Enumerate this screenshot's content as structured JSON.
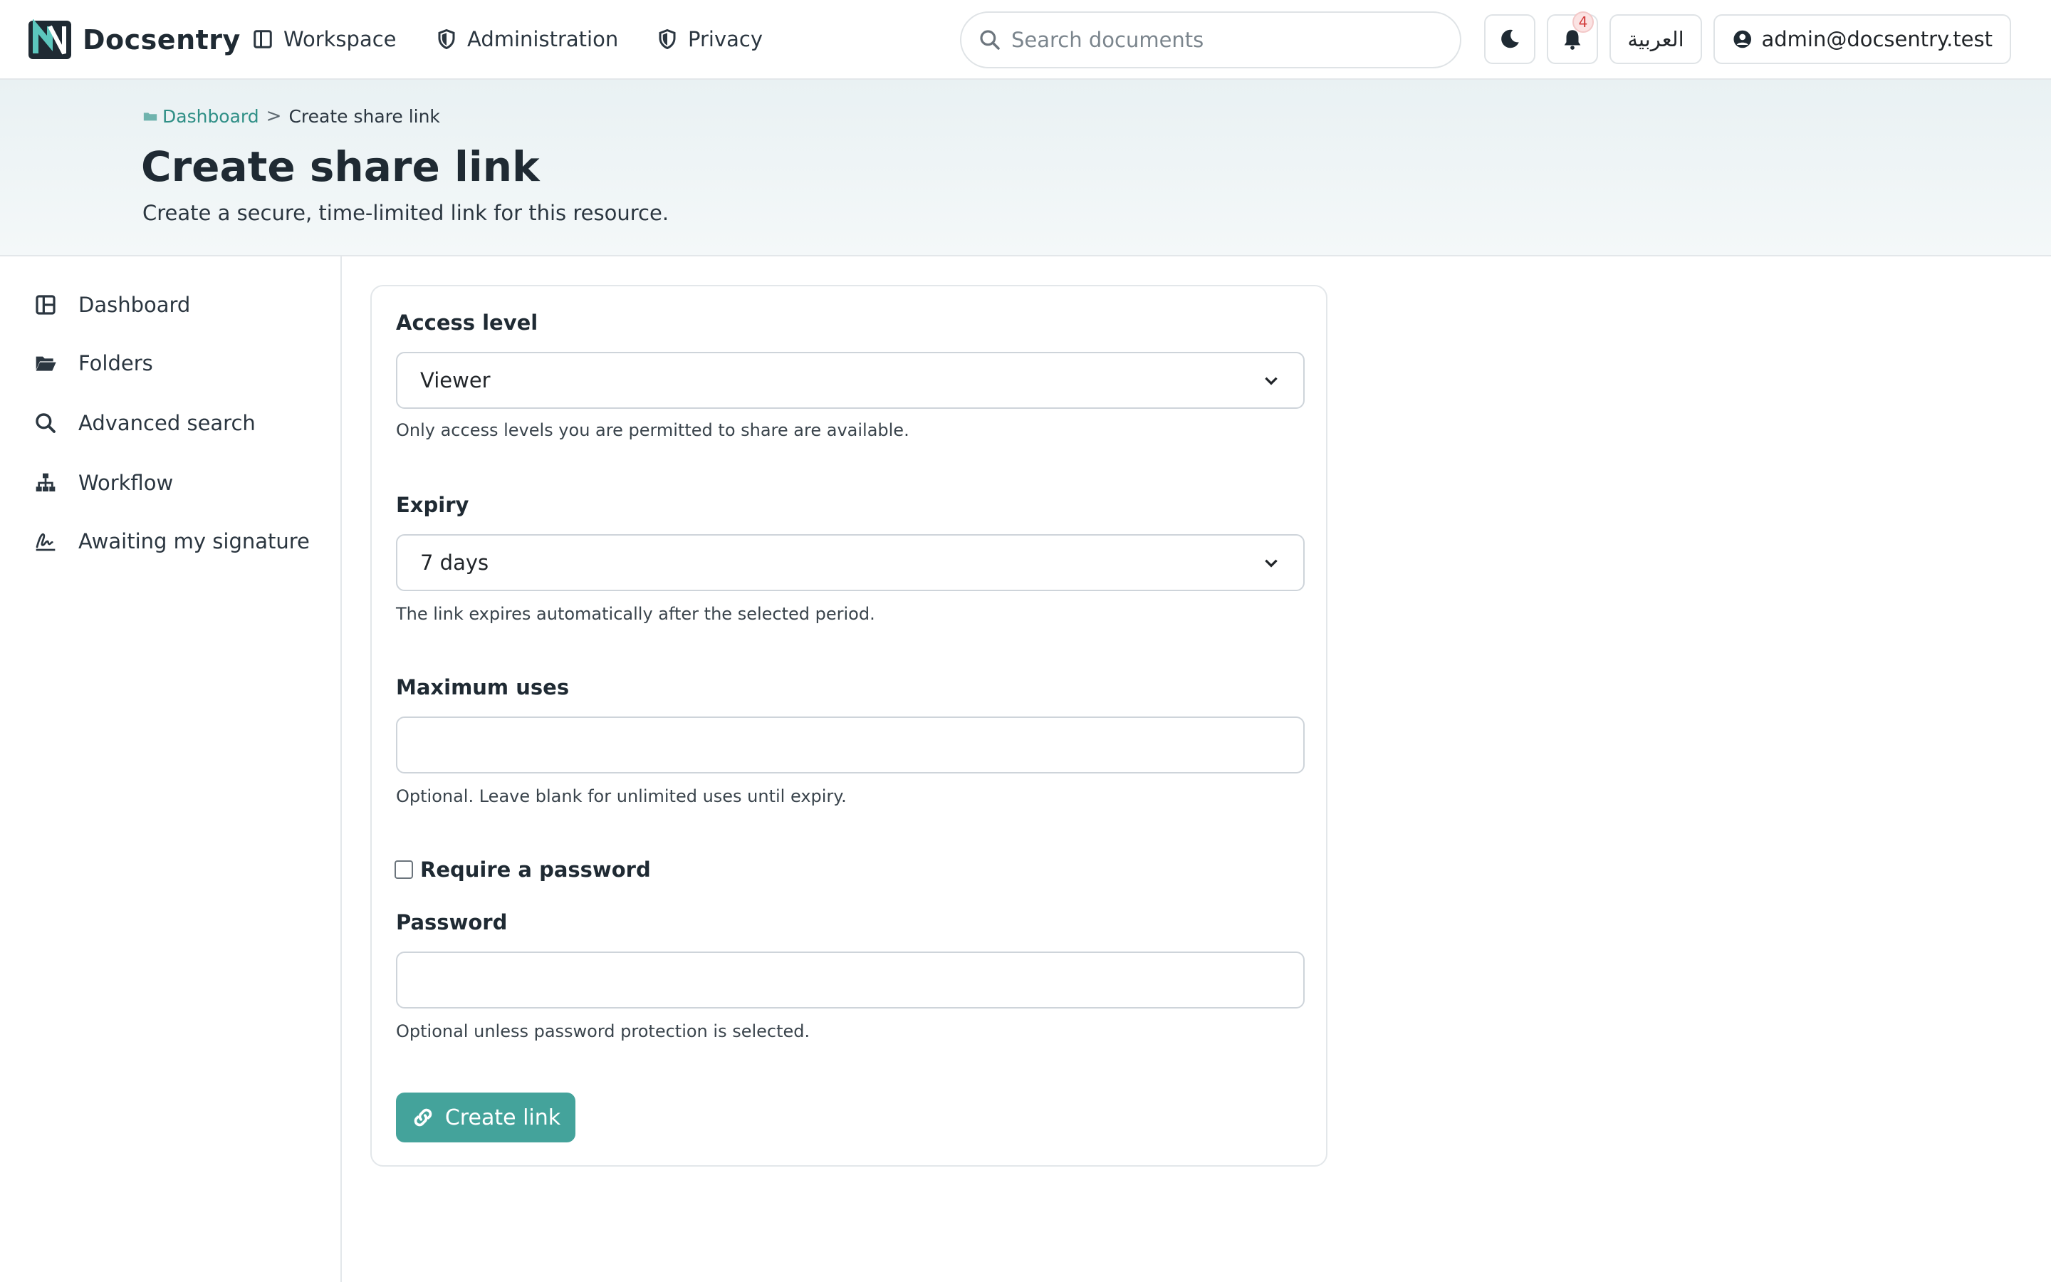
{
  "brand": {
    "name": "Docsentry"
  },
  "nav": [
    {
      "label": "Workspace",
      "icon": "layout-icon"
    },
    {
      "label": "Administration",
      "icon": "shield-icon"
    },
    {
      "label": "Privacy",
      "icon": "shield-half-icon"
    }
  ],
  "search": {
    "placeholder": "Search documents",
    "value": ""
  },
  "notifications": {
    "count": "4"
  },
  "language": {
    "label": "العربية"
  },
  "user": {
    "email": "admin@docsentry.test"
  },
  "breadcrumb": {
    "home": "Dashboard",
    "separator": ">",
    "current": "Create share link"
  },
  "page": {
    "title": "Create share link",
    "subtitle": "Create a secure, time-limited link for this resource."
  },
  "sidebar": {
    "items": [
      {
        "label": "Dashboard",
        "icon": "layout-icon"
      },
      {
        "label": "Folders",
        "icon": "folder-open-icon"
      },
      {
        "label": "Advanced search",
        "icon": "search-icon"
      },
      {
        "label": "Workflow",
        "icon": "sitemap-icon"
      },
      {
        "label": "Awaiting my signature",
        "icon": "signature-icon"
      }
    ]
  },
  "form": {
    "access_level": {
      "label": "Access level",
      "value": "Viewer",
      "help": "Only access levels you are permitted to share are available."
    },
    "expiry": {
      "label": "Expiry",
      "value": "7 days",
      "help": "The link expires automatically after the selected period."
    },
    "max_uses": {
      "label": "Maximum uses",
      "value": "",
      "help": "Optional. Leave blank for unlimited uses until expiry."
    },
    "require_password": {
      "label": "Require a password",
      "checked": false
    },
    "password": {
      "label": "Password",
      "value": "",
      "help": "Optional unless password protection is selected."
    },
    "submit_label": "Create link"
  },
  "colors": {
    "accent": "#44a39b",
    "link": "#2f8f86",
    "badge": "#d23b3b",
    "header_bg": "#e9f1f3"
  }
}
